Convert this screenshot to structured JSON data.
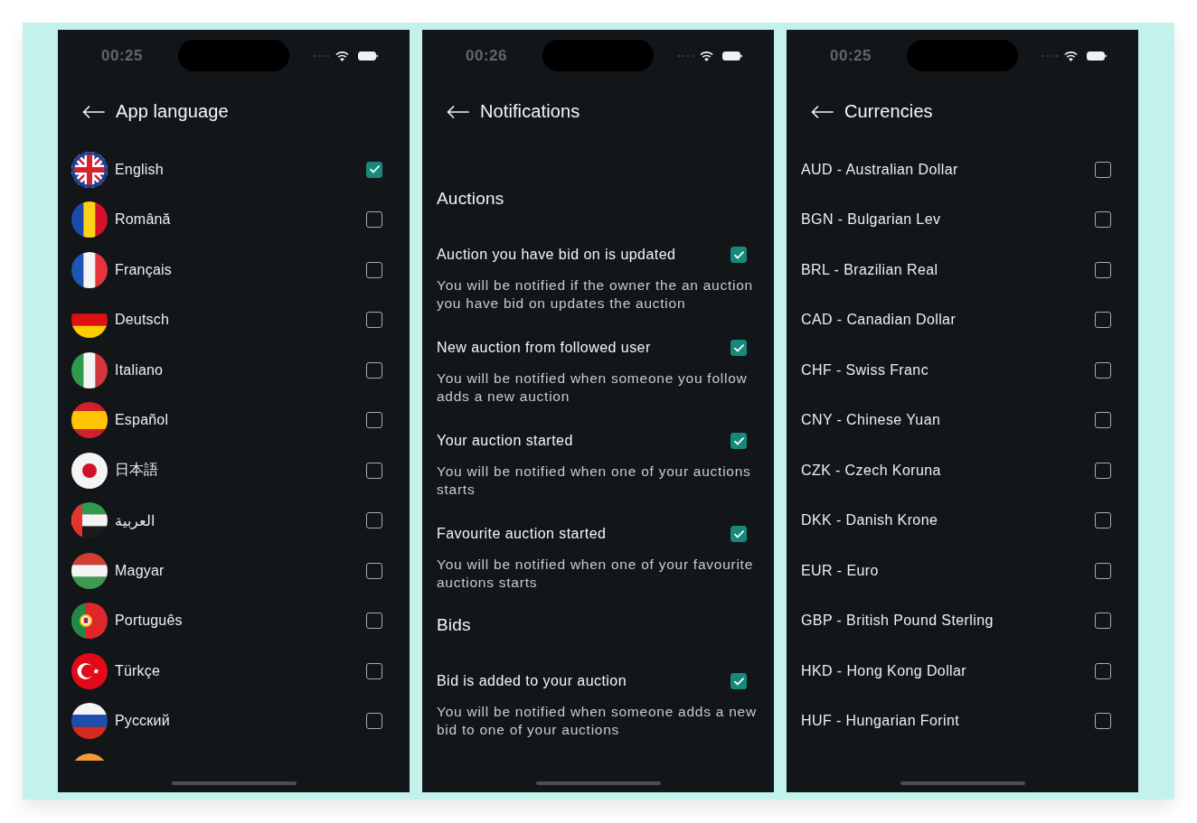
{
  "app_language": {
    "status_bar": {
      "time": "00:25"
    },
    "title": "App language",
    "languages": [
      {
        "name": "English",
        "checked": true
      },
      {
        "name": "Română",
        "checked": false
      },
      {
        "name": "Français",
        "checked": false
      },
      {
        "name": "Deutsch",
        "checked": false
      },
      {
        "name": "Italiano",
        "checked": false
      },
      {
        "name": "Español",
        "checked": false
      },
      {
        "name": "日本語",
        "checked": false
      },
      {
        "name": "العربية",
        "checked": false
      },
      {
        "name": "Magyar",
        "checked": false
      },
      {
        "name": "Português",
        "checked": false
      },
      {
        "name": "Türkçe",
        "checked": false
      },
      {
        "name": "Русский",
        "checked": false
      }
    ]
  },
  "notifications": {
    "status_bar": {
      "time": "00:26"
    },
    "title": "Notifications",
    "sections": [
      {
        "heading": "Auctions",
        "items": [
          {
            "title": "Auction you have bid on is updated",
            "description": "You will be notified if the owner the an auction you have bid on updates the auction",
            "checked": true
          },
          {
            "title": "New auction from followed user",
            "description": "You will be notified when someone you follow adds a new auction",
            "checked": true
          },
          {
            "title": "Your auction started",
            "description": "You will be notified when one of your auctions starts",
            "checked": true
          },
          {
            "title": "Favourite auction started",
            "description": "You will be notified when one of your favourite auctions starts",
            "checked": true
          }
        ]
      },
      {
        "heading": "Bids",
        "items": [
          {
            "title": "Bid is added to your auction",
            "description": "You will be notified when someone adds a new bid to one of your auctions",
            "checked": true
          }
        ]
      }
    ]
  },
  "currencies": {
    "status_bar": {
      "time": "00:25"
    },
    "title": "Currencies",
    "items": [
      {
        "name": "AUD - Australian Dollar",
        "checked": false
      },
      {
        "name": "BGN - Bulgarian Lev",
        "checked": false
      },
      {
        "name": "BRL - Brazilian Real",
        "checked": false
      },
      {
        "name": "CAD - Canadian Dollar",
        "checked": false
      },
      {
        "name": "CHF - Swiss Franc",
        "checked": false
      },
      {
        "name": "CNY - Chinese Yuan",
        "checked": false
      },
      {
        "name": "CZK - Czech Koruna",
        "checked": false
      },
      {
        "name": "DKK - Danish Krone",
        "checked": false
      },
      {
        "name": "EUR - Euro",
        "checked": false
      },
      {
        "name": "GBP - British Pound Sterling",
        "checked": false
      },
      {
        "name": "HKD - Hong Kong Dollar",
        "checked": false
      },
      {
        "name": "HUF - Hungarian Forint",
        "checked": false
      }
    ]
  }
}
